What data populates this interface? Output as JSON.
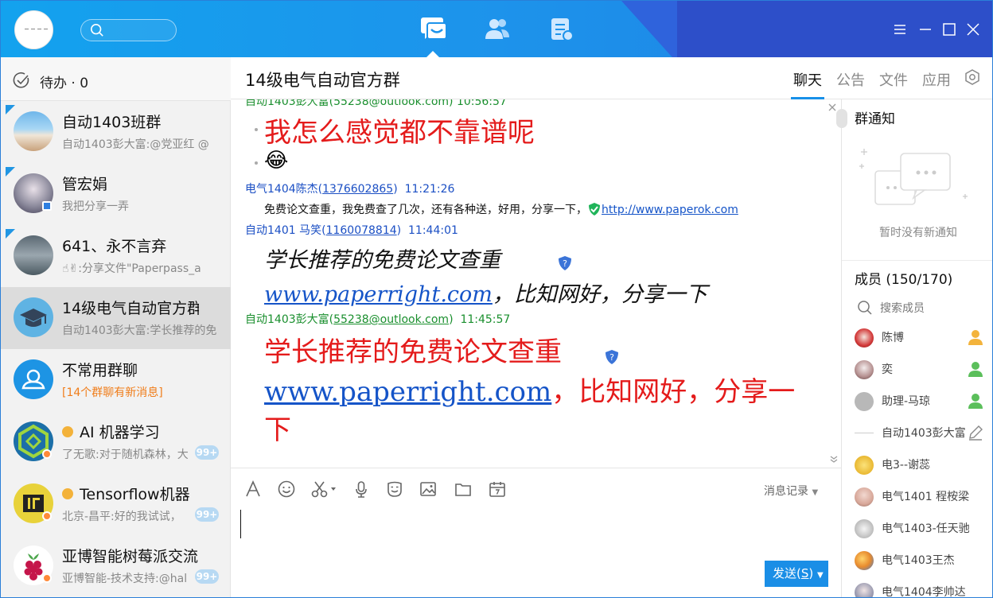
{
  "sidebar": {
    "todo_label": "待办 · 0",
    "conversations": [
      {
        "name": "自动1403班群",
        "preview": "自动1403彭大富:@党亚红 @"
      },
      {
        "name": "管宏娟",
        "preview": "我把分享一弄"
      },
      {
        "name": "641、永不言弃",
        "preview": "☝✌:分享文件\"Paperpass_a"
      },
      {
        "name": "14级电气自动官方群",
        "preview": "自动1403彭大富:学长推荐的免"
      },
      {
        "name": "不常用群聊",
        "preview": "[14个群聊有新消息]"
      },
      {
        "name": "AI 机器学习",
        "preview": "了无歌:对于随机森林，大",
        "badge": "99+"
      },
      {
        "name": "Tensorflow机器",
        "preview": "北京-昌平:好的我试试，",
        "badge": "99+"
      },
      {
        "name": "亚博智能树莓派交流",
        "preview": "亚博智能-技术支持:@hal",
        "badge": "99+"
      }
    ]
  },
  "chat": {
    "title": "14级电气自动官方群",
    "tabs": [
      "聊天",
      "公告",
      "文件",
      "应用"
    ],
    "messages": {
      "m0_header": "自动1403彭大富(55238@outlook.com)  10:56:57",
      "m0_text": "我怎么感觉都不靠谱呢",
      "m0_emoji": "😂",
      "m1_sender": "电气1404陈杰",
      "m1_qq": "1376602865",
      "m1_time": "11:21:26",
      "m1_text": "免费论文查重，我免费查了几次，还有各种送，好用，分享一下，",
      "m1_link": "http://www.paperok.com",
      "m2_sender": "自动1401 马笑",
      "m2_qq": "1160078814",
      "m2_time": "11:44:01",
      "m2_line1": "学长推荐的免费论文查重",
      "m2_link": "www.paperright.com",
      "m2_line2": "，比知网好，分享一下",
      "m3_sender": "自动1403彭大富",
      "m3_qq": "55238@outlook.com",
      "m3_time": "11:45:57",
      "m3_line1": "学长推荐的免费论文查重",
      "m3_link": "www.paperright.com",
      "m3_line2a": "，比知网好，分享一",
      "m3_line2b": "下"
    },
    "input": {
      "history_label": "消息记录",
      "send_label": "发送(",
      "send_key": "S",
      "send_close": ")"
    }
  },
  "right_panel": {
    "notice_title": "群通知",
    "notice_empty": "暂时没有新通知",
    "members_title": "成员 (150/170)",
    "search_placeholder": "搜索成员",
    "members": [
      "陈博",
      "奕",
      "助理-马琼",
      "自动1403彭大富",
      "电3--谢蕊",
      "电气1401 程桉梁",
      "电气1403-任天驰",
      "电气1403王杰",
      "电气1404李帅达"
    ]
  },
  "colors": {
    "accent": "#1890e8",
    "title_bar": "#1d93eb",
    "alert_text": "#f07d1a",
    "message_red": "#e41b1b",
    "link_blue": "#1554c8",
    "sender_blue": "#1b4fc4",
    "sender_green": "#1a8f2e"
  }
}
